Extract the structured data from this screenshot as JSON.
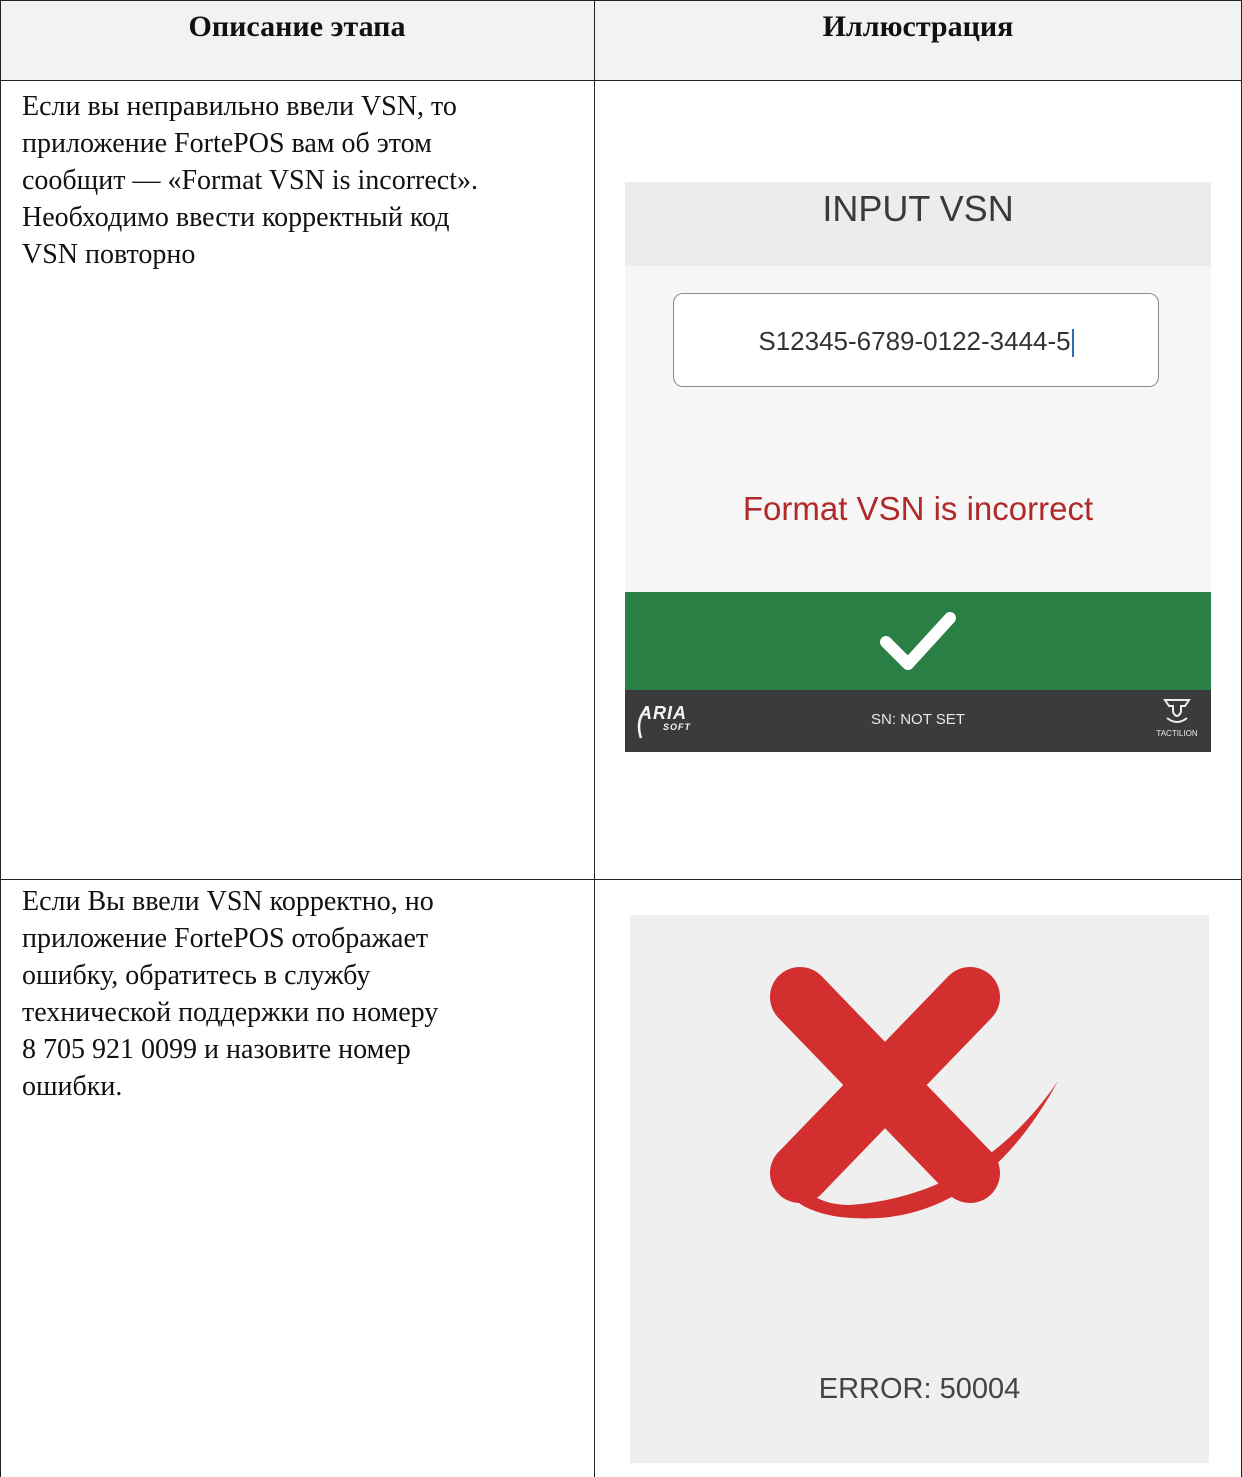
{
  "table": {
    "headers": [
      "Описание этапа",
      "Иллюстрация"
    ],
    "rows": [
      {
        "description_lines": [
          "Если вы неправильно ввели VSN, то",
          "приложение FortePOS вам об этом",
          "сообщит — «Format VSN is incorrect».",
          "Необходимо ввести корректный код",
          "VSN повторно"
        ]
      },
      {
        "description_lines": [
          "Если Вы ввели VSN корректно, но",
          "приложение FortePOS отображает",
          "ошибку, обратитесь в службу",
          "технической поддержки по номеру",
          "8 705 921 0099 и назовите номер",
          "ошибки."
        ]
      }
    ]
  },
  "screen_input": {
    "title": "INPUT VSN",
    "input_value": "S12345-6789-0122-3444-5",
    "error_message": "Format VSN is incorrect",
    "confirm_icon": "checkmark-icon",
    "footer": {
      "logo_main": "ARIA",
      "logo_sub": "SOFT",
      "sn_text": "SN: NOT SET",
      "brand_text": "TACTILION"
    },
    "colors": {
      "ok_bar": "#2a7f45",
      "error_text": "#b02a2a",
      "footer": "#3b3b3b"
    }
  },
  "screen_error": {
    "icon": "red-x-icon",
    "error_code": "ERROR: 50004",
    "colors": {
      "x_color": "#d32f2f"
    }
  }
}
